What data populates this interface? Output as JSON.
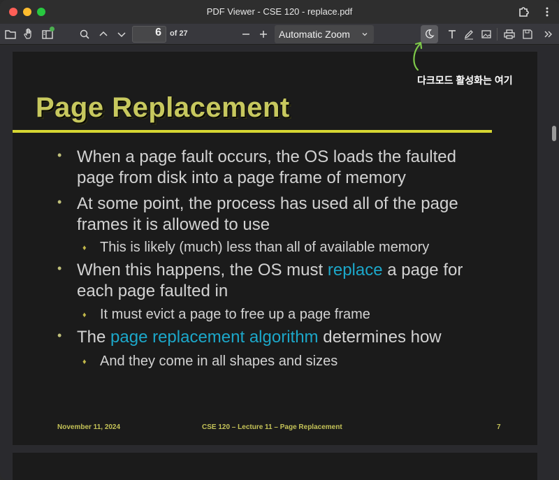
{
  "window": {
    "title": "PDF Viewer - CSE 120 - replace.pdf"
  },
  "toolbar": {
    "page_number": "6",
    "page_count": "of 27",
    "zoom": "Automatic Zoom",
    "icons": [
      "sidebar-folder-icon",
      "hand-tool-icon",
      "sidebar-toggle-icon",
      "search-icon",
      "previous-page-icon",
      "next-page-icon",
      "zoom-out-icon",
      "zoom-in-icon",
      "dark-mode-icon",
      "text-tool-icon",
      "draw-tool-icon",
      "image-tool-icon",
      "print-icon",
      "save-icon",
      "more-tools-icon"
    ]
  },
  "slide": {
    "title": "Page Replacement",
    "bullets": [
      {
        "line1": "When a page fault occurs, the OS loads the faulted",
        "line2": "page from disk into a page frame of memory"
      },
      {
        "line1": "At some point, the process has used all of the page",
        "line2": "frames it is allowed to use",
        "sub": "This is likely (much) less than all of available memory"
      },
      {
        "pre": "When this happens, the OS must ",
        "highlight": "replace",
        "post": " a page for",
        "line2": "each page faulted in",
        "sub": "It must evict a page to free up a page frame"
      },
      {
        "pre": "The ",
        "highlight": "page replacement algorithm",
        "post": " determines how",
        "sub": "And they come in all shapes and sizes"
      }
    ],
    "footer": {
      "date": "November 11, 2024",
      "course": "CSE 120 – Lecture 11 – Page Replacement",
      "page": "7"
    }
  },
  "annotation": {
    "text": "다크모드 활성화는 여기"
  },
  "colors": {
    "title": "#c7c85e",
    "rule": "#d6d632",
    "highlight": "#1ca7c9",
    "annotation_arrow": "#7ec94a"
  }
}
